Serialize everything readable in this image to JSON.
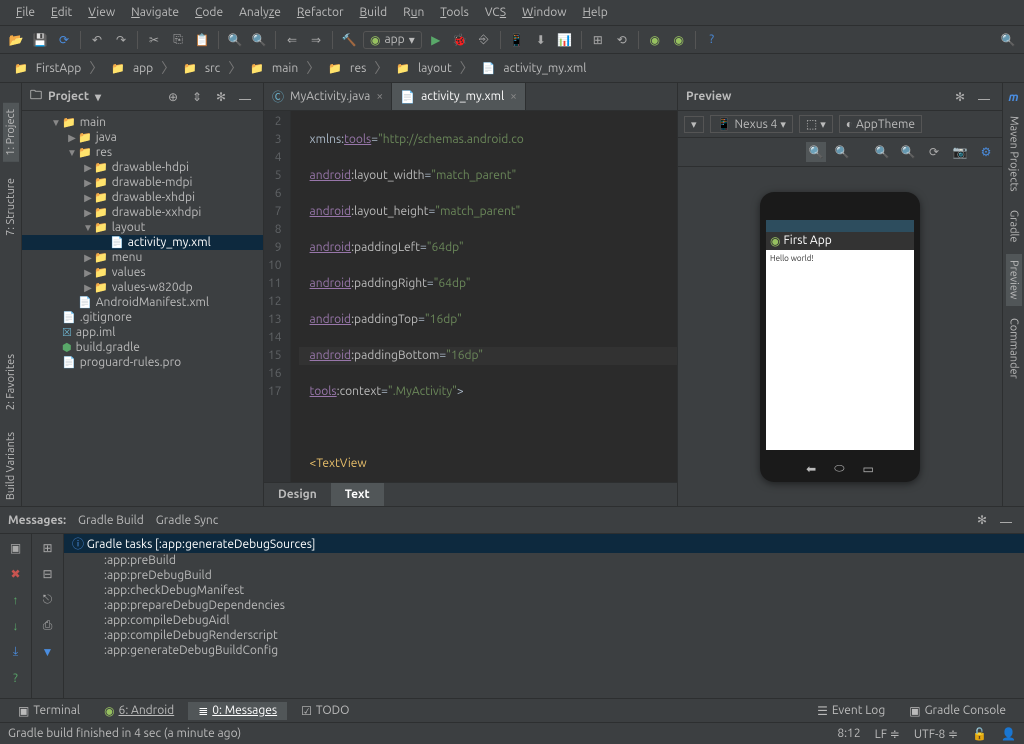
{
  "menu": [
    "File",
    "Edit",
    "View",
    "Navigate",
    "Code",
    "Analyze",
    "Refactor",
    "Build",
    "Run",
    "Tools",
    "VCS",
    "Window",
    "Help"
  ],
  "run_config": "app",
  "breadcrumb": [
    "FirstApp",
    "app",
    "src",
    "main",
    "res",
    "layout",
    "activity_my.xml"
  ],
  "project": {
    "title": "Project",
    "tree": {
      "main": "main",
      "java": "java",
      "res": "res",
      "drawable_hdpi": "drawable-hdpi",
      "drawable_mdpi": "drawable-mdpi",
      "drawable_xhdpi": "drawable-xhdpi",
      "drawable_xxhdpi": "drawable-xxhdpi",
      "layout": "layout",
      "activity_my": "activity_my.xml",
      "menu": "menu",
      "values": "values",
      "values_w820dp": "values-w820dp",
      "manifest": "AndroidManifest.xml",
      "gitignore": ".gitignore",
      "appiml": "app.iml",
      "buildgradle": "build.gradle",
      "proguard": "proguard-rules.pro"
    }
  },
  "editor": {
    "tabs": [
      {
        "label": "MyActivity.java",
        "active": false
      },
      {
        "label": "activity_my.xml",
        "active": true
      }
    ],
    "gutter_start": 2,
    "gutter_end": 17,
    "bottom_tabs": {
      "design": "Design",
      "text": "Text"
    }
  },
  "preview": {
    "title": "Preview",
    "device": "Nexus 4",
    "theme": "AppTheme",
    "app_title": "First App",
    "content": "Hello world!"
  },
  "messages": {
    "title": "Messages:",
    "tabs": [
      "Gradle Build",
      "Gradle Sync"
    ],
    "headline": "Gradle tasks [:app:generateDebugSources]",
    "tasks": [
      ":app:preBuild",
      ":app:preDebugBuild",
      ":app:checkDebugManifest",
      ":app:prepareDebugDependencies",
      ":app:compileDebugAidl",
      ":app:compileDebugRenderscript",
      ":app:generateDebugBuildConfig"
    ]
  },
  "bottom": {
    "terminal": "Terminal",
    "android": "6: Android",
    "messages": "0: Messages",
    "todo": "TODO",
    "eventlog": "Event Log",
    "gradleconsole": "Gradle Console"
  },
  "status": {
    "text": "Gradle build finished in 4 sec (a minute ago)",
    "pos": "8:12",
    "le": "LF",
    "enc": "UTF-8"
  },
  "side_left": {
    "project": "1: Project",
    "structure": "7: Structure",
    "favorites": "2: Favorites",
    "buildvariants": "Build Variants"
  },
  "side_right": {
    "maven": "Maven Projects",
    "gradle": "Gradle",
    "preview": "Preview",
    "commander": "Commander"
  }
}
